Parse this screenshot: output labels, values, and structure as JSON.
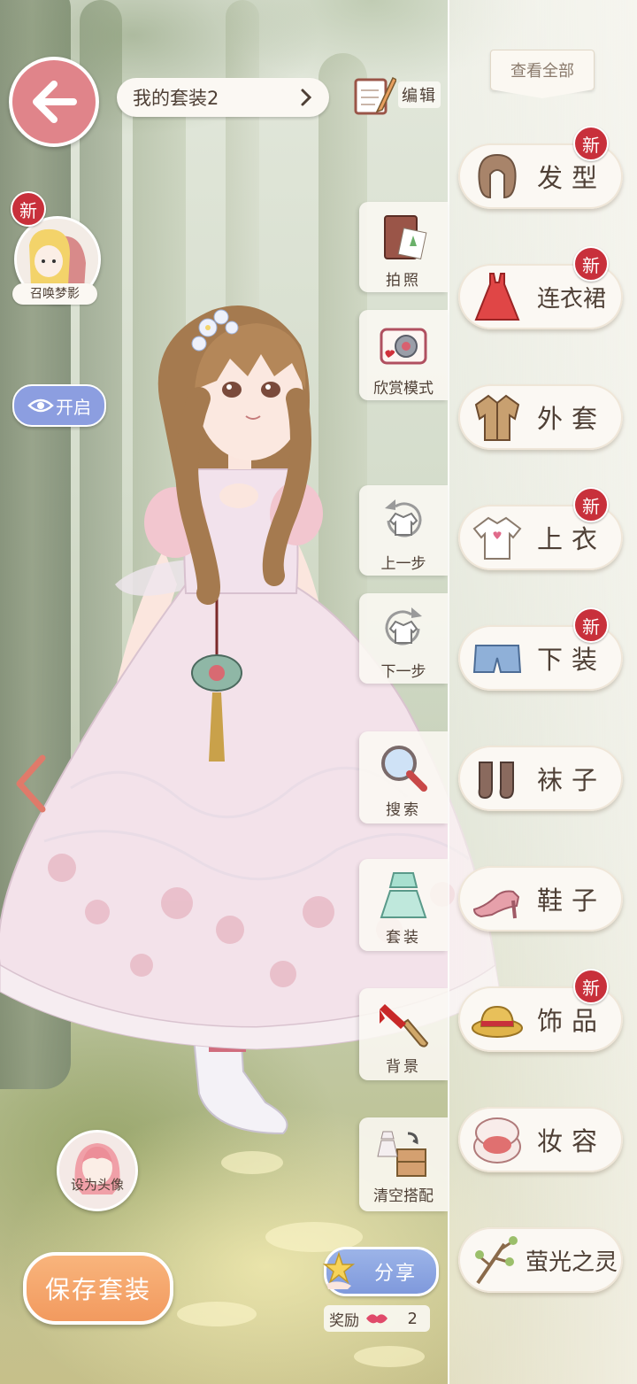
{
  "header": {
    "outfit_name": "我的套装2",
    "edit_label": "编辑"
  },
  "summon": {
    "badge": "新",
    "label": "召唤梦影"
  },
  "toggle": {
    "label": "开启"
  },
  "avatar": {
    "label": "设为头像"
  },
  "save": {
    "label": "保存套装"
  },
  "share": {
    "label": "分享",
    "reward_label": "奖励",
    "reward_count": "2"
  },
  "view_all": "查看全部",
  "tools": [
    {
      "label": "拍照",
      "icon": "photo-album-icon"
    },
    {
      "label": "欣赏模式",
      "icon": "camera-icon"
    },
    {
      "label": "上一步",
      "icon": "undo-icon"
    },
    {
      "label": "下一步",
      "icon": "redo-icon"
    },
    {
      "label": "搜索",
      "icon": "magnifier-icon"
    },
    {
      "label": "套装",
      "icon": "outfit-set-icon"
    },
    {
      "label": "背景",
      "icon": "paint-brush-icon"
    },
    {
      "label": "清空搭配",
      "icon": "clear-outfit-icon"
    }
  ],
  "categories": [
    {
      "label": "发型",
      "icon": "hair-icon",
      "new": "新"
    },
    {
      "label": "连衣裙",
      "icon": "dress-icon",
      "new": "新"
    },
    {
      "label": "外套",
      "icon": "coat-icon",
      "new": ""
    },
    {
      "label": "上衣",
      "icon": "top-icon",
      "new": "新"
    },
    {
      "label": "下装",
      "icon": "shorts-icon",
      "new": "新"
    },
    {
      "label": "袜子",
      "icon": "socks-icon",
      "new": ""
    },
    {
      "label": "鞋子",
      "icon": "shoes-icon",
      "new": ""
    },
    {
      "label": "饰品",
      "icon": "hat-icon",
      "new": "新"
    },
    {
      "label": "妆容",
      "icon": "makeup-icon",
      "new": ""
    },
    {
      "label": "萤光之灵",
      "icon": "branch-icon",
      "new": ""
    }
  ],
  "colors": {
    "accent_pink": "#e0848a",
    "badge_red": "#c8303b",
    "save_orange": "#f29a5f",
    "share_blue": "#8c9ee0",
    "panel_cream": "#fbf8f3",
    "text_brown": "#4e3f35"
  }
}
